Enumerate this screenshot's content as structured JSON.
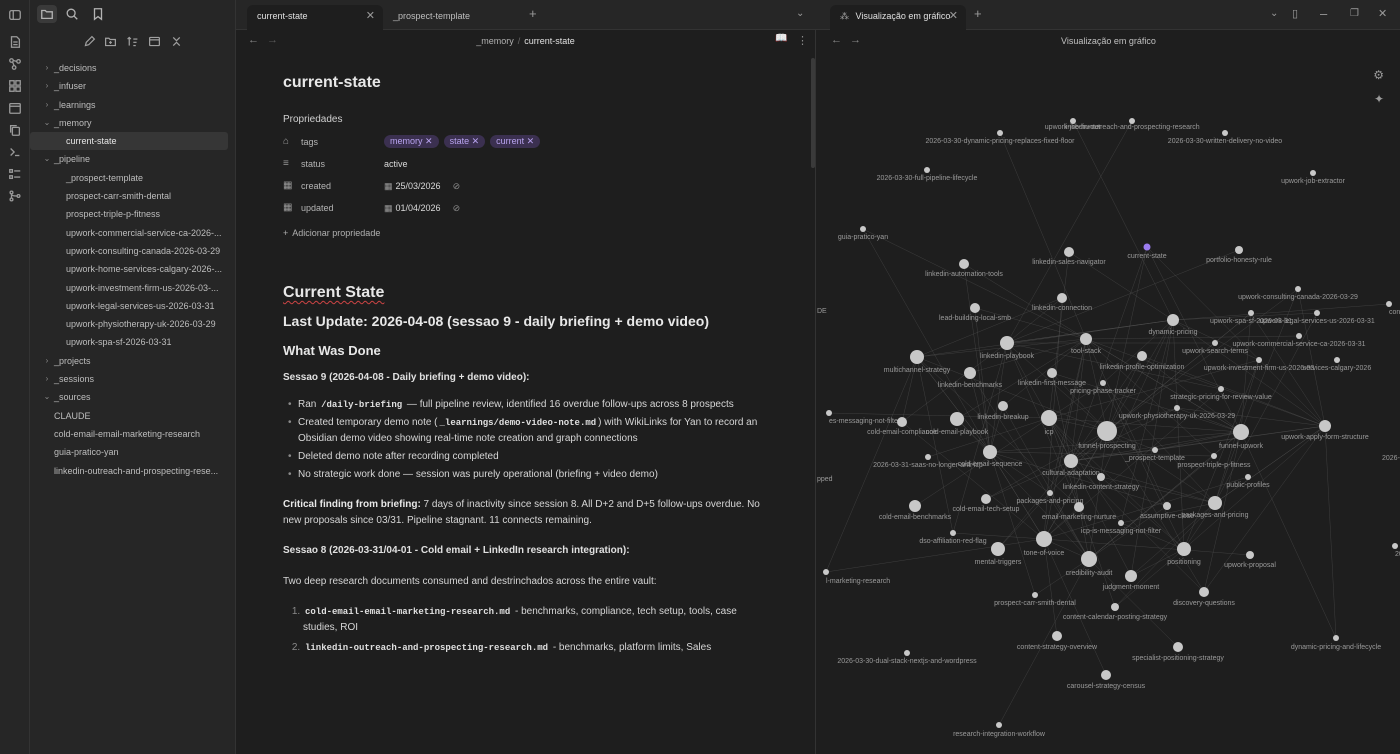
{
  "sidebar": {
    "tree": [
      {
        "label": "_decisions",
        "type": "folder",
        "open": false
      },
      {
        "label": "_infuser",
        "type": "folder",
        "open": false
      },
      {
        "label": "_learnings",
        "type": "folder",
        "open": false
      },
      {
        "label": "_memory",
        "type": "folder",
        "open": true
      },
      {
        "label": "current-state",
        "type": "file",
        "indent": 1,
        "active": true
      },
      {
        "label": "_pipeline",
        "type": "folder",
        "open": true
      },
      {
        "label": "_prospect-template",
        "type": "file",
        "indent": 1
      },
      {
        "label": "prospect-carr-smith-dental",
        "type": "file",
        "indent": 1
      },
      {
        "label": "prospect-triple-p-fitness",
        "type": "file",
        "indent": 1
      },
      {
        "label": "upwork-commercial-service-ca-2026-...",
        "type": "file",
        "indent": 1
      },
      {
        "label": "upwork-consulting-canada-2026-03-29",
        "type": "file",
        "indent": 1
      },
      {
        "label": "upwork-home-services-calgary-2026-...",
        "type": "file",
        "indent": 1
      },
      {
        "label": "upwork-investment-firm-us-2026-03-...",
        "type": "file",
        "indent": 1
      },
      {
        "label": "upwork-legal-services-us-2026-03-31",
        "type": "file",
        "indent": 1
      },
      {
        "label": "upwork-physiotherapy-uk-2026-03-29",
        "type": "file",
        "indent": 1
      },
      {
        "label": "upwork-spa-sf-2026-03-31",
        "type": "file",
        "indent": 1
      },
      {
        "label": "_projects",
        "type": "folder",
        "open": false
      },
      {
        "label": "_sessions",
        "type": "folder",
        "open": false
      },
      {
        "label": "_sources",
        "type": "folder",
        "open": true
      },
      {
        "label": "CLAUDE",
        "type": "file",
        "indent": 0
      },
      {
        "label": "cold-email-email-marketing-research",
        "type": "file",
        "indent": 0
      },
      {
        "label": "guia-pratico-yan",
        "type": "file",
        "indent": 0
      },
      {
        "label": "linkedin-outreach-and-prospecting-rese...",
        "type": "file",
        "indent": 0
      }
    ]
  },
  "tabs": {
    "left": [
      {
        "label": "current-state",
        "active": true
      },
      {
        "label": "_prospect-template",
        "active": false
      }
    ],
    "right": [
      {
        "label": "Visualização em gráfico",
        "active": true
      }
    ]
  },
  "editor": {
    "breadcrumb": {
      "folder": "_memory",
      "sep": "/",
      "file": "current-state"
    },
    "title": "current-state",
    "properties_heading": "Propriedades",
    "properties": {
      "tags_key": "tags",
      "tags": [
        "memory",
        "state",
        "current"
      ],
      "status_key": "status",
      "status_value": "active",
      "created_key": "created",
      "created_value": "25/03/2026",
      "updated_key": "updated",
      "updated_value": "01/04/2026",
      "add_label": "Adicionar propriedade"
    },
    "h1": "Current State",
    "h2": "Last Update: 2026-04-08 (sessao 9 - daily briefing + demo video)",
    "h3_done": "What Was Done",
    "s9_heading": "Sessao 9 (2026-04-08 - Daily briefing + demo video):",
    "s9_b1_pre": "Ran ",
    "s9_b1_code": "/daily-briefing",
    "s9_b1_post": " — full pipeline review, identified 16 overdue follow-ups across 8 prospects",
    "s9_b2_pre": "Created temporary demo note (",
    "s9_b2_code": "_learnings/demo-video-note.md",
    "s9_b2_post": ") with WikiLinks for Yan to record an Obsidian demo video showing real-time note creation and graph connections",
    "s9_b3": "Deleted demo note after recording completed",
    "s9_b4": "No strategic work done — session was purely operational (briefing + video demo)",
    "critical_bold": "Critical finding from briefing:",
    "critical_text": " 7 days of inactivity since session 8. All D+2 and D+5 follow-ups overdue. No new proposals since 03/31. Pipeline stagnant. 11 connects remaining.",
    "s8_heading": "Sessao 8 (2026-03-31/04-01 - Cold email + LinkedIn research integration):",
    "s8_intro": "Two deep research documents consumed and destrinchados across the entire vault:",
    "s8_items": [
      {
        "code": "cold-email-email-marketing-research.md",
        "text": " - benchmarks, compliance, tech setup, tools, case studies, ROI"
      },
      {
        "code": "linkedin-outreach-and-prospecting-research.md",
        "text": " - benchmarks, platform limits, Sales"
      }
    ]
  },
  "graph": {
    "title": "Visualização em gráfico",
    "highlight_color": "#9b7cf0",
    "node_color": "#c8c8c8",
    "nodes": [
      {
        "id": "upwork-job-hunter",
        "label": "upwork-job-hunter"
      },
      {
        "id": "linkedin-outreach-and-prospecting-research",
        "label": "linkedin-outreach-and-prospecting-research"
      },
      {
        "id": "2026-03-30-dynamic-pricing-replaces-fixed-floor",
        "label": "2026-03-30-dynamic-pricing-replaces-fixed-floor"
      },
      {
        "id": "2026-03-30-written-delivery-no-video",
        "label": "2026-03-30-written-delivery-no-video"
      },
      {
        "id": "2026-03-30-full-pipeline-lifecycle",
        "label": "2026-03-30-full-pipeline-lifecycle"
      },
      {
        "id": "upwork-job-extractor",
        "label": "upwork-job-extractor"
      },
      {
        "id": "guia-pratico-yan",
        "label": "guia-pratico-yan"
      },
      {
        "id": "current-state",
        "label": "current-state"
      },
      {
        "id": "linkedin-sales-navigator",
        "label": "linkedin-sales-navigator"
      },
      {
        "id": "portfolio-honesty-rule",
        "label": "portfolio-honesty-rule"
      },
      {
        "id": "linkedin-automation-tools",
        "label": "linkedin-automation-tools"
      },
      {
        "id": "upwork-consulting-canada-2026-03-29",
        "label": "upwork-consulting-canada-2026-03-29"
      },
      {
        "id": "content-s",
        "label": "content-s"
      },
      {
        "id": "linkedin-connection",
        "label": "linkedin-connection"
      },
      {
        "id": "lead-building-local-smb",
        "label": "lead-building-local-smb"
      },
      {
        "id": "upwork-spa-sf-2026-03-31",
        "label": "upwork-spa-sf-2026-03-31"
      },
      {
        "id": "upwork-legal-services-us-2026-03-31",
        "label": "upwork-legal-services-us-2026-03-31"
      },
      {
        "id": "dynamic-pricing",
        "label": "dynamic-pricing"
      },
      {
        "id": "de",
        "label": "DE"
      },
      {
        "id": "upwork-commercial-service-ca-2026-03-31",
        "label": "upwork-commercial-service-ca-2026-03-31"
      },
      {
        "id": "tool-stack",
        "label": "tool-stack"
      },
      {
        "id": "linkedin-playbook",
        "label": "linkedin-playbook"
      },
      {
        "id": "upwork-search-terms",
        "label": "upwork-search-terms"
      },
      {
        "id": "multichannel-strategy",
        "label": "multichannel-strategy"
      },
      {
        "id": "linkedin-profile-optimization",
        "label": "linkedin-profile-optimization"
      },
      {
        "id": "upwork-investment-firm-us-2026-03",
        "label": "upwork-investment-firm-us-2026-03"
      },
      {
        "id": "services-calgary-2026",
        "label": "services-calgary-2026"
      },
      {
        "id": "linkedin-benchmarks",
        "label": "linkedin-benchmarks"
      },
      {
        "id": "linkedin-first-message",
        "label": "linkedin-first-message"
      },
      {
        "id": "pricing-phase-tracker",
        "label": "pricing-phase-tracker"
      },
      {
        "id": "strategic-pricing-for-review-value",
        "label": "strategic-pricing-for-review-value"
      },
      {
        "id": "linkedin-breakup",
        "label": "linkedin-breakup"
      },
      {
        "id": "upwork-physiotherapy-uk-2026-03-29",
        "label": "upwork-physiotherapy-uk-2026-03-29"
      },
      {
        "id": "es-messaging-not-filter",
        "label": "es-messaging-not-filter"
      },
      {
        "id": "cold-email-compliance",
        "label": "cold-email-compliance"
      },
      {
        "id": "cold-email-playbook",
        "label": "cold-email-playbook"
      },
      {
        "id": "icp",
        "label": "icp"
      },
      {
        "id": "upwork-apply-form-structure",
        "label": "upwork-apply-form-structure"
      },
      {
        "id": "funnel-prospecting",
        "label": "funnel-prospecting"
      },
      {
        "id": "funnel-upwork",
        "label": "funnel-upwork"
      },
      {
        "id": "2026-03-29",
        "label": "2026-03-29"
      },
      {
        "id": "prospect-template",
        "label": "_prospect-template"
      },
      {
        "id": "2026-03-31-saas-no-longer-anti-icp",
        "label": "2026-03-31-saas-no-longer-anti-icp"
      },
      {
        "id": "cold-email-sequence",
        "label": "cold-email-sequence"
      },
      {
        "id": "prospect-triple-p-fitness",
        "label": "prospect-triple-p-fitness"
      },
      {
        "id": "cultural-adaptation",
        "label": "cultural-adaptation"
      },
      {
        "id": "pped",
        "label": "pped"
      },
      {
        "id": "linkedin-content-strategy",
        "label": "linkedin-content-strategy"
      },
      {
        "id": "public-profiles",
        "label": "public-profiles"
      },
      {
        "id": "packages-and-pricing-a",
        "label": "packages-and-pricing"
      },
      {
        "id": "cold-email-tech-setup",
        "label": "cold-email-tech-setup"
      },
      {
        "id": "cold-email-benchmarks",
        "label": "cold-email-benchmarks"
      },
      {
        "id": "email-marketing-nurture",
        "label": "email-marketing-nurture"
      },
      {
        "id": "assumptive-close",
        "label": "assumptive-close"
      },
      {
        "id": "packages-and-pricing-b",
        "label": "packages-and-pricing"
      },
      {
        "id": "icp-is-messaging-not-filter",
        "label": "icp-is-messaging-not-filter"
      },
      {
        "id": "dso-affiliation-red-flag",
        "label": "dso-affiliation-red-flag"
      },
      {
        "id": "tone-of-voice",
        "label": "tone-of-voice"
      },
      {
        "id": "mental-triggers",
        "label": "mental-triggers"
      },
      {
        "id": "positioning",
        "label": "positioning"
      },
      {
        "id": "upwork-proposal",
        "label": "upwork-proposal"
      },
      {
        "id": "2026-03-30-content-strate",
        "label": "2026-03-30-content-strate"
      },
      {
        "id": "credibility-audit",
        "label": "credibility-audit"
      },
      {
        "id": "judgment-moment",
        "label": "judgment-moment"
      },
      {
        "id": "l-marketing-research",
        "label": "l-marketing-research"
      },
      {
        "id": "prospect-carr-smith-dental",
        "label": "prospect-carr-smith-dental"
      },
      {
        "id": "discovery-questions",
        "label": "discovery-questions"
      },
      {
        "id": "content-calendar-posting-strategy",
        "label": "content-calendar-posting-strategy"
      },
      {
        "id": "content-strategy-overview",
        "label": "content-strategy-overview"
      },
      {
        "id": "specialist-positioning-strategy",
        "label": "specialist-positioning-strategy"
      },
      {
        "id": "dynamic-pricing-and-lifecycle",
        "label": "dynamic-pricing-and-lifecycle"
      },
      {
        "id": "2026-03-30-dual-stack-nextjs-and-wordpress",
        "label": "2026-03-30-dual-stack-nextjs-and-wordpress"
      },
      {
        "id": "carousel-strategy-census",
        "label": "carousel-strategy-census"
      },
      {
        "id": "research-integration-workflow",
        "label": "research-integration-workflow"
      }
    ]
  }
}
